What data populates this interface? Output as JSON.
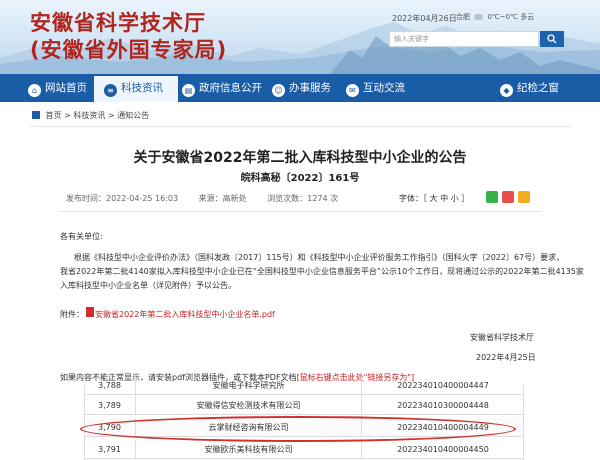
{
  "header": {
    "title_line1": "安徽省科学技术厅",
    "title_line2": "(安徽省外国专家局)",
    "date": "2022年04月26日",
    "weather": "合肥",
    "weather_extra": "0℃~0℃",
    "weather_desc": "多云",
    "search_placeholder": "输入关键字"
  },
  "nav": {
    "items": [
      {
        "label": "网站首页",
        "icon": "home-icon"
      },
      {
        "label": "科技资讯",
        "icon": "news-icon"
      },
      {
        "label": "政府信息公开",
        "icon": "book-icon"
      },
      {
        "label": "办事服务",
        "icon": "people-icon"
      },
      {
        "label": "互动交流",
        "icon": "chat-icon"
      },
      {
        "label": "纪检之窗",
        "icon": "shield-icon"
      }
    ]
  },
  "breadcrumb": {
    "home": "首页",
    "sep": ">",
    "level1": "科技资讯",
    "level2": "通知公告"
  },
  "article": {
    "title": "关于安徽省2022年第二批入库科技型中小企业的公告",
    "doc_no": "皖科高秘〔2022〕161号",
    "publish_time": "发布时间：2022-04-25 16:03",
    "source": "来源：高新处",
    "views": "浏览次数：1274 次",
    "font_label": "字体：",
    "font_sizes": "［ 大 中 小 ］",
    "greeting": "各有关单位:",
    "para_line1": "根据《科技型中小企业评价办法》（国科发政〔2017〕115号）和《科技型中小企业评价服务工作指引》（国科火字〔2022〕67号）要求，",
    "para_line2": "我省2022年第二批4140家拟入库科技型中小企业已在“全国科技型中小企业信息服务平台”公示10个工作日，现将通过公示的2022年第二批4135家",
    "para_line3": "入库科技型中小企业名单（详见附件）予以公告。",
    "attachment_label": "附件：",
    "attachment_name": "安徽省2022年第二批入库科技型中小企业名单.pdf",
    "signer": "安徽省科学技术厅",
    "sign_date": "2022年4月25日",
    "tip_prefix": "如果内容不能正常显示，请安装pdf浏览器插件，或下载本PDF文档",
    "tip_link": "[鼠标右键点击此处\"链接另存为\"]"
  },
  "table": {
    "rows": [
      {
        "no": "3,788",
        "name": "安徽电子科学研究所",
        "code": "202234010400004447"
      },
      {
        "no": "3,789",
        "name": "安徽得信安检测技术有限公司",
        "code": "202234010300004448"
      },
      {
        "no": "3,790",
        "name": "云掌财经咨询有限公司",
        "code": "202234010400004449"
      },
      {
        "no": "3,791",
        "name": "安徽欧乐美科技有限公司",
        "code": "202234010400004450"
      }
    ],
    "highlight_color": "#d0312d"
  },
  "colors": {
    "brand_red": "#b0261f",
    "nav_blue": "#1a5da7",
    "link_red": "#c81f1f"
  }
}
